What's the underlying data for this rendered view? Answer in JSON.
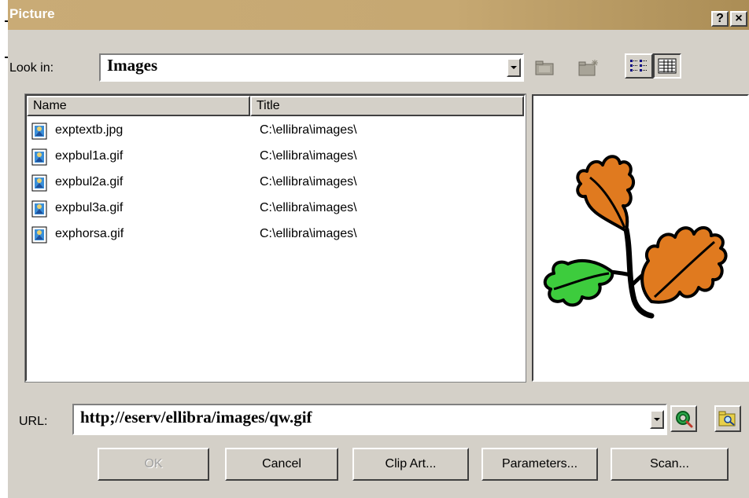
{
  "window": {
    "title": "Picture",
    "help_label": "?",
    "close_label": "×"
  },
  "look_in": {
    "label": "Look in:",
    "value": "Images"
  },
  "toolbar": {
    "icons": [
      "up-folder-icon",
      "new-folder-icon",
      "list-view-icon",
      "details-view-icon"
    ]
  },
  "file_list": {
    "columns": [
      "Name",
      "Title"
    ],
    "rows": [
      {
        "name": "exptextb.jpg",
        "title": "C:\\ellibra\\images\\"
      },
      {
        "name": "expbul1a.gif",
        "title": "C:\\ellibra\\images\\"
      },
      {
        "name": "expbul2a.gif",
        "title": "C:\\ellibra\\images\\"
      },
      {
        "name": "expbul3a.gif",
        "title": "C:\\ellibra\\images\\"
      },
      {
        "name": "exphorsa.gif",
        "title": "C:\\ellibra\\images\\"
      }
    ]
  },
  "url": {
    "label": "URL:",
    "value": "http;//eserv/ellibra/images/qw.gif"
  },
  "buttons": {
    "ok": "OK",
    "cancel": "Cancel",
    "clip_art": "Clip Art...",
    "parameters": "Parameters...",
    "scan": "Scan..."
  },
  "colors": {
    "dialog_face": "#d4d0c8",
    "titlebar": "#c6a872",
    "leaf_orange": "#e07a1f",
    "leaf_green": "#3dcc3d"
  }
}
